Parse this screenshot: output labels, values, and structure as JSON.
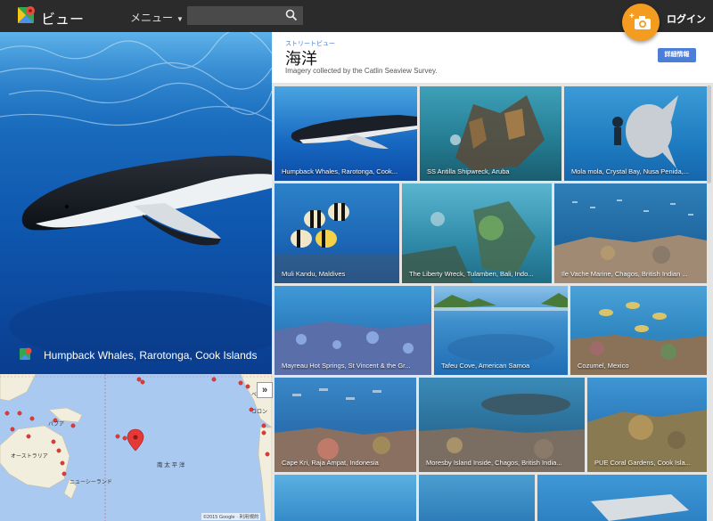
{
  "topbar": {
    "app_title": "ビュー",
    "menu_label": "メニュー",
    "login_label": "ログイン",
    "search": {
      "placeholder": "",
      "value": ""
    }
  },
  "hero": {
    "caption": "Humpback Whales, Rarotonga, Cook Islands"
  },
  "map": {
    "labels": [
      "オーストラリア",
      "パプア",
      "ニューシーランド",
      "南 太 平 洋",
      "コロン",
      "ベネズ"
    ],
    "copyright": "©2015 Google · 利用規約"
  },
  "collection": {
    "eyebrow": "ストリートビュー",
    "title": "海洋",
    "subtitle": "Imagery collected by the Catlin Seaview Survey.",
    "details_button": "詳細情報"
  },
  "tiles": [
    {
      "caption": "Humpback Whales, Rarotonga, Cook..."
    },
    {
      "caption": "SS Antilla Shipwreck, Aruba"
    },
    {
      "caption": "Mola mola, Crystal Bay, Nusa Penida,..."
    },
    {
      "caption": "Muli Kandu, Maldives"
    },
    {
      "caption": "The Liberty Wreck, Tulamben, Bali, Indo..."
    },
    {
      "caption": "Ile Vache Marine, Chagos, British Indian ..."
    },
    {
      "caption": "Mayreau Hot Springs, St Vincent & the Gr..."
    },
    {
      "caption": "Tafeu Cove, American Samoa"
    },
    {
      "caption": "Cozumel, Mexico"
    },
    {
      "caption": "Cape Kri, Raja Ampat, Indonesia"
    },
    {
      "caption": "Moresby Island Inside, Chagos, British India..."
    },
    {
      "caption": "PUE Coral Gardens, Cook Isla..."
    },
    {
      "caption": ""
    },
    {
      "caption": ""
    },
    {
      "caption": ""
    }
  ],
  "colors": {
    "accent_orange": "#f39c1f",
    "button_blue": "#4a7ed8",
    "topbar": "#2b2b2b"
  },
  "icons": [
    "maps-logo-icon",
    "search-icon",
    "camera-add-icon",
    "map-pin-icon",
    "expand-arrows-icon"
  ]
}
